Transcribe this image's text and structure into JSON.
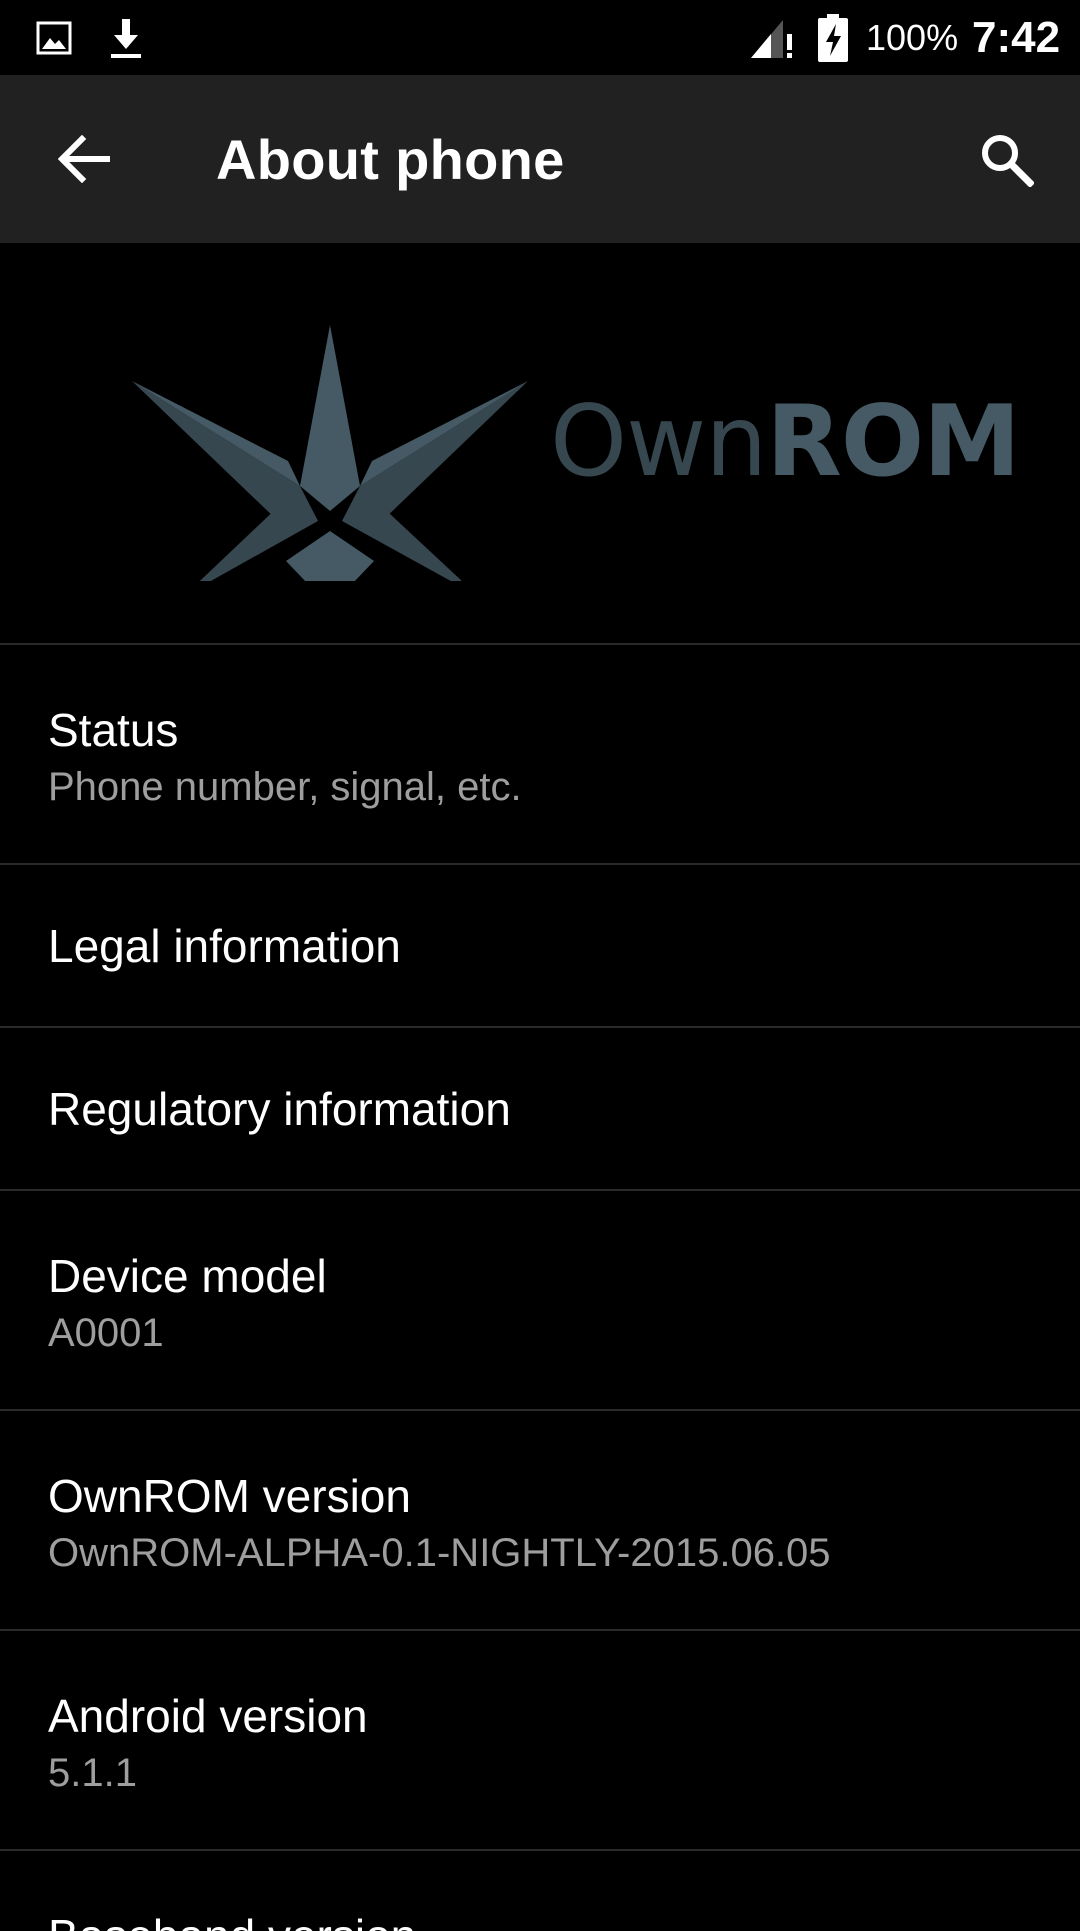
{
  "status_bar": {
    "icons": [
      "image-notification-icon",
      "download-notification-icon",
      "signal-icon",
      "battery-charging-icon"
    ],
    "battery": "100%",
    "time": "7:42"
  },
  "app_bar": {
    "title": "About phone",
    "back_icon": "arrow-back-icon",
    "search_icon": "search-icon"
  },
  "logo": {
    "text_part1": "Own",
    "text_part2": "ROM"
  },
  "settings": {
    "items": [
      {
        "title": "Status",
        "summary": "Phone number, signal, etc."
      },
      {
        "title": "Legal information"
      },
      {
        "title": "Regulatory information"
      },
      {
        "title": "Device model",
        "summary": "A0001"
      },
      {
        "title": "OwnROM version",
        "summary": "OwnROM-ALPHA-0.1-NIGHTLY-2015.06.05"
      },
      {
        "title": "Android version",
        "summary": "5.1.1"
      },
      {
        "title": "Baseband version"
      }
    ]
  },
  "colors": {
    "background": "#000000",
    "app_bar": "#212121",
    "primary_text": "#ffffff",
    "secondary_text": "#9e9e9e",
    "logo": "#455a64"
  }
}
